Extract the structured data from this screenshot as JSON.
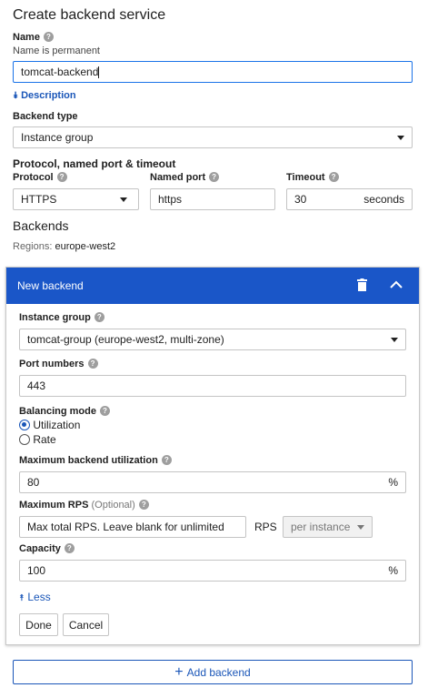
{
  "page": {
    "title": "Create backend service"
  },
  "name": {
    "label": "Name",
    "hint": "Name is permanent",
    "value": "tomcat-backend"
  },
  "description_toggle": {
    "label": "Description"
  },
  "backend_type": {
    "label": "Backend type",
    "value": "Instance group"
  },
  "protocol_section": {
    "heading": "Protocol, named port & timeout",
    "protocol_label": "Protocol",
    "protocol_value": "HTTPS",
    "named_port_label": "Named port",
    "named_port_value": "https",
    "timeout_label": "Timeout",
    "timeout_value": "30",
    "timeout_unit": "seconds"
  },
  "backends": {
    "heading": "Backends",
    "regions_label": "Regions:",
    "regions_value": "europe-west2"
  },
  "new_backend": {
    "title": "New backend",
    "instance_group_label": "Instance group",
    "instance_group_value": "tomcat-group (europe-west2, multi-zone)",
    "port_numbers_label": "Port numbers",
    "port_numbers_value": "443",
    "balancing_mode_label": "Balancing mode",
    "mode_utilization": "Utilization",
    "mode_rate": "Rate",
    "selected_mode": "Utilization",
    "max_util_label": "Maximum backend utilization",
    "max_util_value": "80",
    "percent": "%",
    "max_rps_label": "Maximum RPS",
    "max_rps_optional": "(Optional)",
    "max_rps_placeholder": "Max total RPS. Leave blank for unlimited",
    "rps_unit": "RPS",
    "rps_scope": "per instance",
    "capacity_label": "Capacity",
    "capacity_value": "100",
    "less_label": "Less",
    "done_label": "Done",
    "cancel_label": "Cancel"
  },
  "add_backend": {
    "label": "Add backend"
  },
  "colors": {
    "accent": "#1a56c8",
    "link": "#1a56b8",
    "focus": "#1a73e8"
  }
}
